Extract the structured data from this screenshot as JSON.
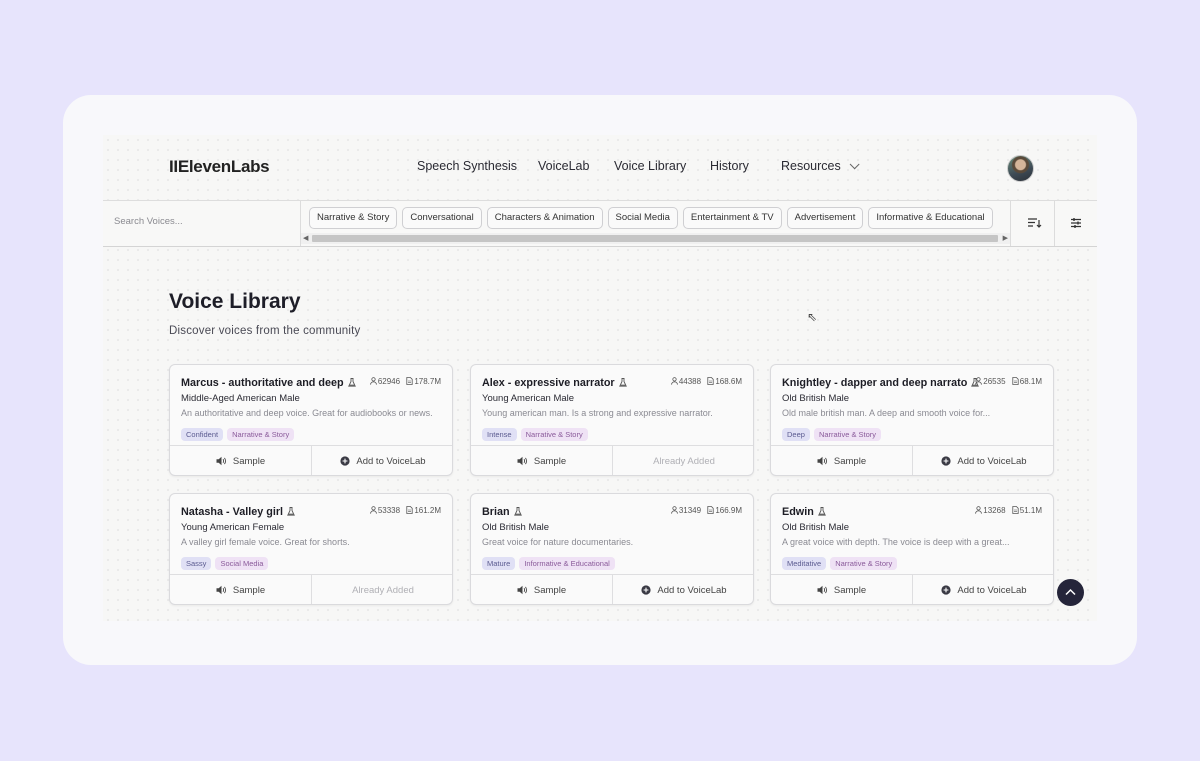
{
  "header": {
    "logo": "IIElevenLabs",
    "nav": [
      "Speech Synthesis",
      "VoiceLab",
      "Voice Library",
      "History",
      "Resources"
    ]
  },
  "filters": {
    "search_placeholder": "Search Voices...",
    "chips": [
      "Narrative & Story",
      "Conversational",
      "Characters & Animation",
      "Social Media",
      "Entertainment & TV",
      "Advertisement",
      "Informative & Educational"
    ]
  },
  "main": {
    "title": "Voice Library",
    "subtitle": "Discover voices from the community"
  },
  "voices": [
    {
      "name": "Marcus - authoritative and deep",
      "users": "62946",
      "chars": "178.7M",
      "type": "Middle-Aged American Male",
      "desc": "An authoritative and deep voice. Great for audiobooks or news.",
      "tags": [
        "Confident",
        "Narrative & Story"
      ],
      "sample": "Sample",
      "action": "Add to VoiceLab",
      "added": false
    },
    {
      "name": "Alex - expressive narrator",
      "users": "44388",
      "chars": "168.6M",
      "type": "Young American Male",
      "desc": "Young american man. Is a strong and expressive narrator.",
      "tags": [
        "Intense",
        "Narrative & Story"
      ],
      "sample": "Sample",
      "action": "Already Added",
      "added": true
    },
    {
      "name": "Knightley - dapper and deep narrato",
      "users": "26535",
      "chars": "68.1M",
      "type": "Old British Male",
      "desc": "Old male british man. A deep and smooth voice for...",
      "tags": [
        "Deep",
        "Narrative & Story"
      ],
      "sample": "Sample",
      "action": "Add to VoiceLab",
      "added": false
    },
    {
      "name": "Natasha - Valley girl",
      "users": "53338",
      "chars": "161.2M",
      "type": "Young American Female",
      "desc": "A valley girl female voice. Great for shorts.",
      "tags": [
        "Sassy",
        "Social Media"
      ],
      "sample": "Sample",
      "action": "Already Added",
      "added": true
    },
    {
      "name": "Brian",
      "users": "31349",
      "chars": "166.9M",
      "type": "Old British Male",
      "desc": "Great voice for nature documentaries.",
      "tags": [
        "Mature",
        "Informative & Educational"
      ],
      "sample": "Sample",
      "action": "Add to VoiceLab",
      "added": false
    },
    {
      "name": "Edwin",
      "users": "13268",
      "chars": "51.1M",
      "type": "Old British Male",
      "desc": "A great voice with depth. The voice is deep with a great...",
      "tags": [
        "Meditative",
        "Narrative & Story"
      ],
      "sample": "Sample",
      "action": "Add to VoiceLab",
      "added": false
    }
  ],
  "colors": {
    "page_bg": "#e7e4fc",
    "tag_primary": "#e0e0f5",
    "tag_secondary": "#efe2f5",
    "fab": "#25253a"
  }
}
